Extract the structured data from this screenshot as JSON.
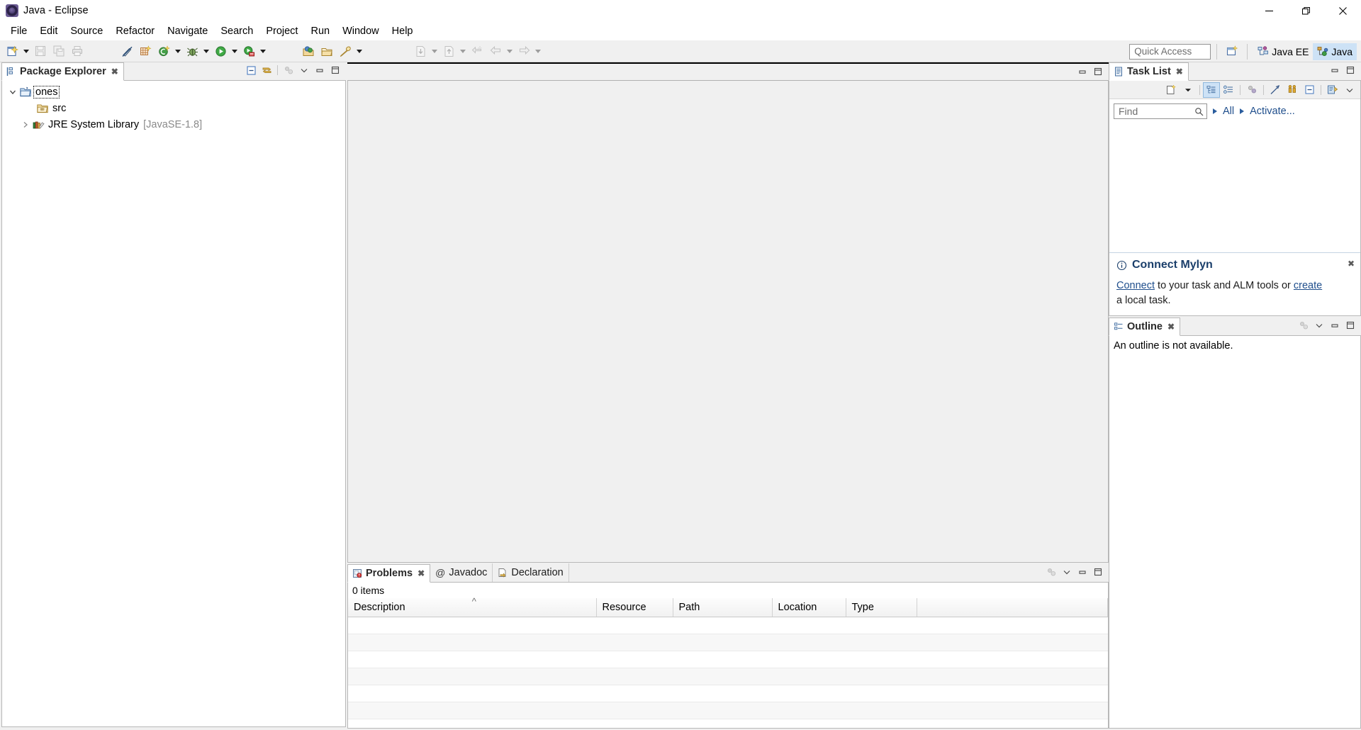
{
  "window": {
    "title": "Java - Eclipse",
    "app_icon": "eclipse-icon",
    "controls": {
      "minimize": "Minimize",
      "restore": "Restore",
      "close": "Close"
    }
  },
  "menubar": {
    "items": [
      {
        "label": "File"
      },
      {
        "label": "Edit"
      },
      {
        "label": "Source"
      },
      {
        "label": "Refactor"
      },
      {
        "label": "Navigate"
      },
      {
        "label": "Search"
      },
      {
        "label": "Project"
      },
      {
        "label": "Run"
      },
      {
        "label": "Window"
      },
      {
        "label": "Help"
      }
    ]
  },
  "toolbar": {
    "buttons": [
      {
        "name": "new-wizard-button",
        "icon": "new-file-icon",
        "enabled": true,
        "dropdown": true
      },
      {
        "name": "save-button",
        "icon": "save-icon",
        "enabled": false,
        "dropdown": false
      },
      {
        "name": "save-all-button",
        "icon": "save-all-icon",
        "enabled": false,
        "dropdown": false
      },
      {
        "name": "print-button",
        "icon": "print-icon",
        "enabled": false,
        "dropdown": false
      },
      {
        "name": "toggle-mark-occurrences-button",
        "icon": "pen-strikethrough-icon",
        "enabled": true,
        "dropdown": false
      },
      {
        "name": "new-java-project-button",
        "icon": "new-java-project-icon",
        "enabled": true,
        "dropdown": false
      },
      {
        "name": "new-class-button",
        "icon": "new-class-icon",
        "enabled": true,
        "dropdown": true
      },
      {
        "name": "debug-button",
        "icon": "bug-icon",
        "enabled": true,
        "dropdown": true
      },
      {
        "name": "run-button",
        "icon": "run-green-play-icon",
        "enabled": true,
        "dropdown": true
      },
      {
        "name": "run-external-tools-button",
        "icon": "external-tools-icon",
        "enabled": true,
        "dropdown": true
      },
      {
        "name": "open-type-button",
        "icon": "open-type-icon",
        "enabled": true,
        "dropdown": false
      },
      {
        "name": "open-task-button",
        "icon": "open-folder-icon",
        "enabled": true,
        "dropdown": false
      },
      {
        "name": "search-button",
        "icon": "search-pencil-icon",
        "enabled": true,
        "dropdown": true
      },
      {
        "name": "next-annotation-button",
        "icon": "next-annotation-icon",
        "enabled": false,
        "dropdown": true
      },
      {
        "name": "previous-annotation-button",
        "icon": "previous-annotation-icon",
        "enabled": false,
        "dropdown": true
      },
      {
        "name": "last-edit-location-button",
        "icon": "last-edit-location-icon",
        "enabled": false,
        "dropdown": false
      },
      {
        "name": "back-button",
        "icon": "back-arrow-icon",
        "enabled": false,
        "dropdown": true
      },
      {
        "name": "forward-button",
        "icon": "forward-arrow-icon",
        "enabled": false,
        "dropdown": true
      }
    ],
    "quick_access": {
      "placeholder": "Quick Access",
      "value": ""
    },
    "open_perspective": {
      "name": "open-perspective-icon",
      "tooltip": "Open Perspective"
    },
    "perspectives": [
      {
        "label": "Java EE",
        "icon": "java-ee-perspective-icon",
        "active": false
      },
      {
        "label": "Java",
        "icon": "java-perspective-icon",
        "active": true
      }
    ]
  },
  "package_explorer": {
    "tab": {
      "label": "Package Explorer",
      "icon": "package-explorer-icon",
      "closeable": true
    },
    "actions": [
      {
        "name": "collapse-all-button",
        "icon": "collapse-all-icon"
      },
      {
        "name": "link-with-editor-button",
        "icon": "link-with-editor-icon"
      },
      {
        "name": "view-menu-focus-button",
        "icon": "focus-icon"
      },
      {
        "name": "view-menu-button",
        "icon": "chevron-down-icon"
      },
      {
        "name": "minimize-button",
        "icon": "minimize-icon"
      },
      {
        "name": "maximize-button",
        "icon": "maximize-icon"
      }
    ],
    "tree": [
      {
        "label": "ones",
        "icon": "java-project-icon",
        "indent": 0,
        "expanded": true,
        "has_twisty": true,
        "selected": true,
        "suffix": ""
      },
      {
        "label": "src",
        "icon": "source-folder-icon",
        "indent": 1,
        "expanded": false,
        "has_twisty": false,
        "selected": false,
        "suffix": ""
      },
      {
        "label": "JRE System Library",
        "icon": "jre-library-icon",
        "indent": 1,
        "expanded": false,
        "has_twisty": true,
        "selected": false,
        "suffix": "[JavaSE-1.8]"
      }
    ]
  },
  "editor_area": {
    "actions": [
      {
        "name": "restore-button",
        "icon": "restore-icon"
      },
      {
        "name": "maximize-button",
        "icon": "maximize-icon"
      }
    ]
  },
  "problems_view": {
    "tabs": [
      {
        "label": "Problems",
        "icon": "problems-icon",
        "active": true,
        "closeable": true
      },
      {
        "label": "Javadoc",
        "icon": "javadoc-at-icon",
        "active": false,
        "closeable": false
      },
      {
        "label": "Declaration",
        "icon": "declaration-icon",
        "active": false,
        "closeable": false
      }
    ],
    "actions": [
      {
        "name": "view-menu-focus-button",
        "icon": "focus-icon"
      },
      {
        "name": "view-menu-button",
        "icon": "chevron-down-icon"
      },
      {
        "name": "minimize-button",
        "icon": "minimize-icon"
      },
      {
        "name": "maximize-button",
        "icon": "maximize-icon"
      }
    ],
    "status": "0 items",
    "columns": [
      {
        "label": "Description",
        "sorted": true
      },
      {
        "label": "Resource",
        "sorted": false
      },
      {
        "label": "Path",
        "sorted": false
      },
      {
        "label": "Location",
        "sorted": false
      },
      {
        "label": "Type",
        "sorted": false
      }
    ],
    "rows": []
  },
  "task_list": {
    "tab": {
      "label": "Task List",
      "icon": "task-list-icon",
      "closeable": true
    },
    "actions": [
      {
        "name": "minimize-button",
        "icon": "minimize-icon"
      },
      {
        "name": "maximize-button",
        "icon": "maximize-icon"
      }
    ],
    "toolbar": [
      {
        "name": "new-task-button",
        "icon": "new-task-icon",
        "active": false
      },
      {
        "name": "new-task-dropdown",
        "icon": "chevron-down-icon",
        "active": false
      },
      {
        "name": "categorized-presentation-button",
        "icon": "categorized-icon",
        "active": true
      },
      {
        "name": "scheduled-presentation-button",
        "icon": "scheduled-icon",
        "active": false
      },
      {
        "name": "focus-on-workweek-button",
        "icon": "focus-icon",
        "active": false
      },
      {
        "name": "collapse-all-button",
        "icon": "collapse-all-icon",
        "active": false
      },
      {
        "name": "restore-tasks-button",
        "icon": "restore-tasks-icon",
        "active": false
      },
      {
        "name": "minimize-task-button",
        "icon": "minimize-small-icon",
        "active": false
      },
      {
        "name": "synchronize-changed-button",
        "icon": "synchronize-icon",
        "active": false
      },
      {
        "name": "view-menu-button",
        "icon": "chevron-down-icon",
        "active": false
      }
    ],
    "find": {
      "placeholder": "Find",
      "value": "",
      "icon": "search-icon"
    },
    "filters": [
      {
        "label": "All",
        "name": "filter-all"
      },
      {
        "label": "Activate...",
        "name": "filter-activate"
      }
    ],
    "mylyn": {
      "icon": "info-icon",
      "title": "Connect Mylyn",
      "body_prefix": "",
      "link1": "Connect",
      "mid": " to your task and ALM tools or ",
      "link2": "create",
      "suffix": " a local task.",
      "close": "close-icon"
    }
  },
  "outline": {
    "tab": {
      "label": "Outline",
      "icon": "outline-icon",
      "closeable": true
    },
    "actions": [
      {
        "name": "focus-icon-button",
        "icon": "focus-icon"
      },
      {
        "name": "view-menu-button",
        "icon": "chevron-down-icon"
      },
      {
        "name": "minimize-button",
        "icon": "minimize-icon"
      },
      {
        "name": "maximize-button",
        "icon": "maximize-icon"
      }
    ],
    "message": "An outline is not available."
  },
  "colors": {
    "accent_blue": "#cde2f6",
    "link": "#1f4e8c",
    "mylyn_title": "#1b3f6b",
    "dim_text": "#8a8a8a",
    "panel_bg": "#f0f0f0",
    "border": "#b8b8b8"
  }
}
